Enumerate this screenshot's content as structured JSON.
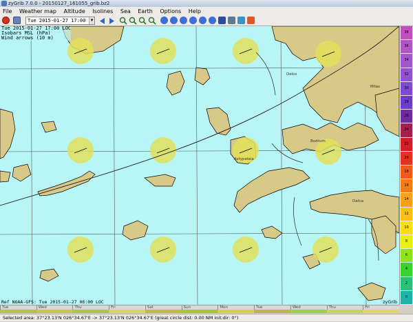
{
  "window": {
    "title": "zyGrib 7.0.0 - 20150127_161055_grib.bz2"
  },
  "menu": [
    "File",
    "Weather map",
    "Altitude",
    "Isolines",
    "Sea",
    "Earth",
    "Options",
    "Help"
  ],
  "toolbar": {
    "date_value": "Tue 2015-01-27 17:00 LOC"
  },
  "map": {
    "info_line1": "Tue 2015-01-27 17:00 LOC",
    "info_line2": "Isobars MSL (hPa)",
    "info_line3": "Wind arrows (10 m)",
    "places": [
      {
        "label": "Delos"
      },
      {
        "label": "Milas"
      },
      {
        "label": "Bodrum"
      },
      {
        "label": "Astypalaia"
      },
      {
        "label": "Datca"
      }
    ],
    "ref_text": "Ref NOAA-GFS: Tue 2015-01-27 06:00 LOC",
    "logo": "zyGrib"
  },
  "scale": [
    "38",
    "36",
    "34",
    "32",
    "30",
    "28",
    "26",
    "24",
    "22",
    "20",
    "18",
    "16",
    "14",
    "12",
    "10",
    "8",
    "6",
    "4",
    "2",
    "0"
  ],
  "scale_colors": [
    "#c24fbf",
    "#b054c6",
    "#a456cc",
    "#8f52d0",
    "#7f49cf",
    "#6a3ec8",
    "#6e2b9c",
    "#a51f4a",
    "#d11e24",
    "#e3331e",
    "#ef5a1b",
    "#f47c17",
    "#f89f14",
    "#fbc012",
    "#f7df12",
    "#e7ef13",
    "#91e21c",
    "#3ad22d",
    "#27c27a",
    "#1fb3a7"
  ],
  "timeline": {
    "days": [
      "Tue",
      "Wed",
      "Thu",
      "Fri",
      "Sat",
      "Sun",
      "Mon",
      "Tue",
      "Wed",
      "Thu",
      "Fri"
    ],
    "strip_colors": [
      "#b8c23a",
      "#c7c93a",
      "#b0c63a",
      "#d8d36a",
      "#c0b84a",
      "#a8c044",
      "#d4cc5c",
      "#bcb642",
      "#9ecf52",
      "#c5d364",
      "#e3d56a"
    ]
  },
  "status": {
    "text": "Selected area:  37°23.13'N  026°34.67'E  ->  37°23.13'N  026°34.67'E   (great circle dist: 0.00 NM  init.dir: 0°)"
  }
}
